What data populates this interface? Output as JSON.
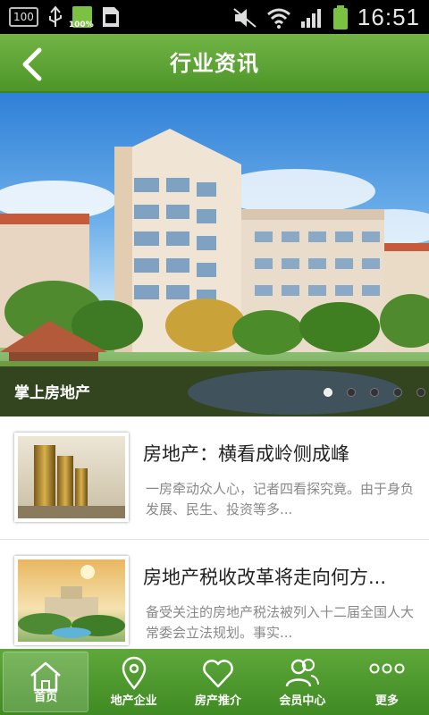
{
  "status_bar": {
    "left_box": "100",
    "battery_small_label": "100%",
    "time": "16:51",
    "icons": [
      "usb-icon",
      "battery-icon",
      "sim-icon",
      "mute-icon",
      "wifi-icon",
      "signal-icon",
      "battery-icon"
    ]
  },
  "header": {
    "title": "行业资讯",
    "back_icon": "chevron-left-icon"
  },
  "banner": {
    "caption": "掌上房地产",
    "slide_count": 5,
    "active_slide": 1
  },
  "news": [
    {
      "title": "房地产：横看成岭侧成峰",
      "summary": "一房牵动众人心，记者四看探究竟。由于身负发展、民生、投资等多..."
    },
    {
      "title": "房地产税收改革将走向何方...",
      "summary": "备受关注的房地产税法被列入十二届全国人大常委会立法规划。事实..."
    }
  ],
  "bottom_nav": [
    {
      "label": "首页",
      "icon": "home-icon",
      "active": true
    },
    {
      "label": "地产企业",
      "icon": "location-pin-icon",
      "active": false
    },
    {
      "label": "房产推介",
      "icon": "heart-icon",
      "active": false
    },
    {
      "label": "会员中心",
      "icon": "users-icon",
      "active": false
    },
    {
      "label": "更多",
      "icon": "more-dots-icon",
      "active": false
    }
  ],
  "colors": {
    "header_green": "#5aa335",
    "nav_green": "#4c9a2c"
  }
}
